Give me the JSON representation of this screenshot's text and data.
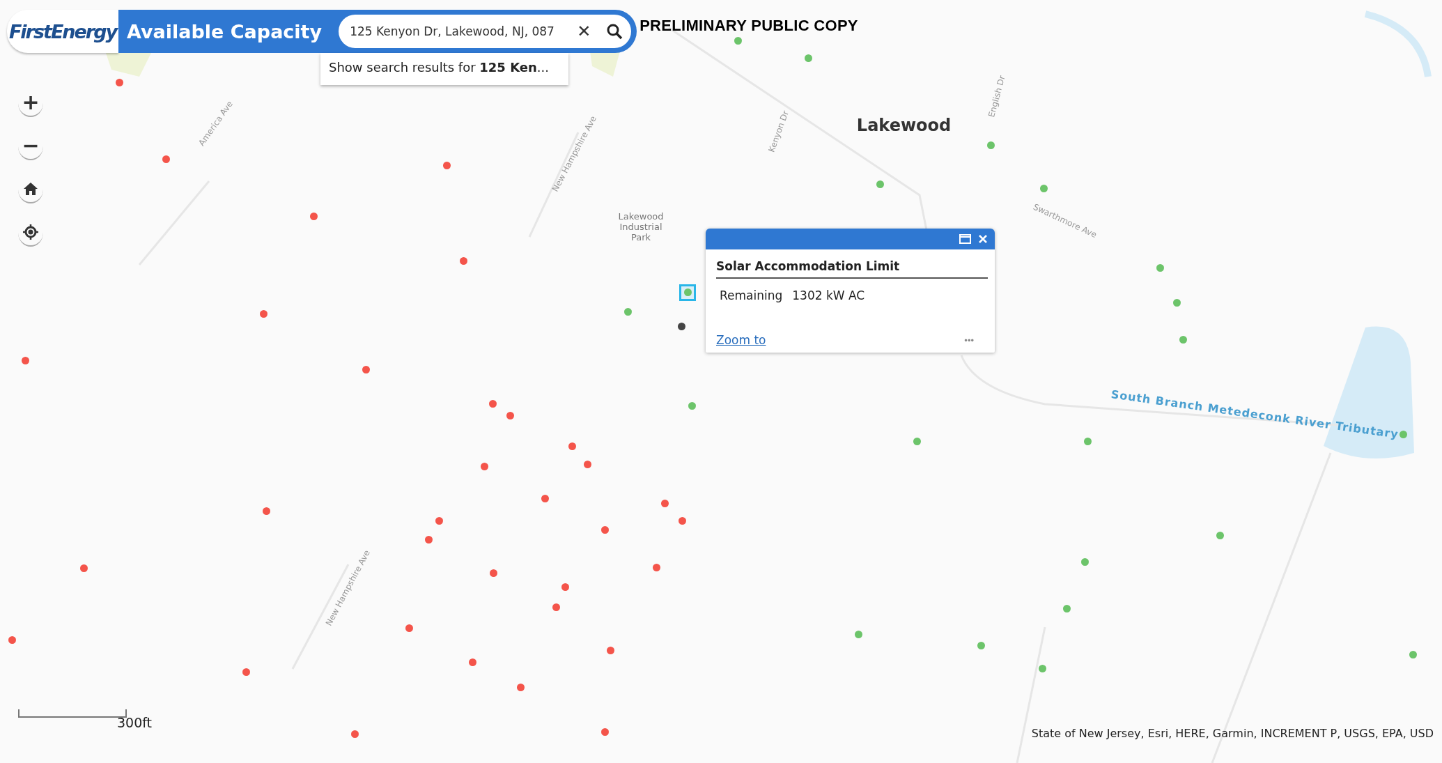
{
  "header": {
    "logo": "FirstEnergy",
    "title": "Available Capacity",
    "search": {
      "value": "125 Kenyon Dr, Lakewood, NJ, 087",
      "clear": "✕"
    },
    "notice": "PRELIMINARY PUBLIC COPY",
    "suggestion": "Show search results for **125 Ken**..."
  },
  "zoom_controls": [
    {
      "kind": "zoom-in",
      "label": "+"
    },
    {
      "kind": "zoom-out",
      "label": "−"
    },
    {
      "kind": "home"
    },
    {
      "kind": "locate"
    }
  ],
  "map_labels": [
    {
      "kind": "place",
      "text": "Lakewood"
    },
    {
      "kind": "area",
      "text": "Lakewood Industrial Park"
    },
    {
      "kind": "water",
      "text": "South Branch Metedeconk River Tributary"
    },
    {
      "kind": "street",
      "text": "New Hampshire Ave"
    },
    {
      "kind": "street",
      "text": "New Hampshire Ave"
    },
    {
      "kind": "street",
      "text": "Kenyon Dr"
    },
    {
      "kind": "street",
      "text": "Swarthmore Ave"
    },
    {
      "kind": "street",
      "text": "America Ave"
    },
    {
      "kind": "street",
      "text": "English Dr"
    }
  ],
  "dots": [
    {
      "color": "#f4544a"
    },
    {
      "color": "#f4544a"
    },
    {
      "color": "#f4544a"
    },
    {
      "color": "#f4544a"
    },
    {
      "color": "#f4544a"
    },
    {
      "color": "#f4544a"
    },
    {
      "color": "#f4544a"
    },
    {
      "color": "#f4544a"
    },
    {
      "color": "#f4544a"
    },
    {
      "color": "#f4544a"
    },
    {
      "color": "#f4544a"
    },
    {
      "color": "#f4544a"
    },
    {
      "color": "#f4544a"
    },
    {
      "color": "#f4544a"
    },
    {
      "color": "#f4544a"
    },
    {
      "color": "#f4544a"
    },
    {
      "color": "#f4544a"
    },
    {
      "color": "#f4544a"
    },
    {
      "color": "#f4544a"
    },
    {
      "color": "#f4544a"
    },
    {
      "color": "#f4544a"
    },
    {
      "color": "#f4544a"
    },
    {
      "color": "#f4544a"
    },
    {
      "color": "#f4544a"
    },
    {
      "color": "#f4544a"
    },
    {
      "color": "#f4544a"
    },
    {
      "color": "#f4544a"
    },
    {
      "color": "#f4544a"
    },
    {
      "color": "#f4544a"
    },
    {
      "color": "#f4544a"
    },
    {
      "color": "#f4544a"
    },
    {
      "color": "#f4544a"
    },
    {
      "color": "#f4544a"
    },
    {
      "color": "#6cc46a"
    },
    {
      "color": "#6cc46a"
    },
    {
      "color": "#6cc46a"
    },
    {
      "color": "#6cc46a"
    },
    {
      "color": "#6cc46a"
    },
    {
      "color": "#6cc46a"
    },
    {
      "color": "#6cc46a"
    },
    {
      "color": "#6cc46a"
    },
    {
      "color": "#6cc46a"
    },
    {
      "color": "#6cc46a"
    },
    {
      "color": "#6cc46a"
    },
    {
      "color": "#6cc46a"
    },
    {
      "color": "#6cc46a"
    },
    {
      "color": "#6cc46a"
    },
    {
      "color": "#6cc46a"
    },
    {
      "color": "#6cc46a"
    },
    {
      "color": "#6cc46a"
    },
    {
      "color": "#6cc46a"
    },
    {
      "color": "#6cc46a"
    },
    {
      "color": "#6cc46a"
    },
    {
      "color": "#6cc46a",
      "selected": true
    },
    {
      "color": "#444444"
    }
  ],
  "popup": {
    "title": "Solar Accommodation Limit",
    "field": "Remaining",
    "value": "1302 kW AC",
    "link": "Zoom to",
    "more": "•••"
  },
  "scale_bar": "300ft",
  "attribution": "State of New Jersey, Esri, HERE, Garmin, INCREMENT P, USGS, EPA, USD"
}
